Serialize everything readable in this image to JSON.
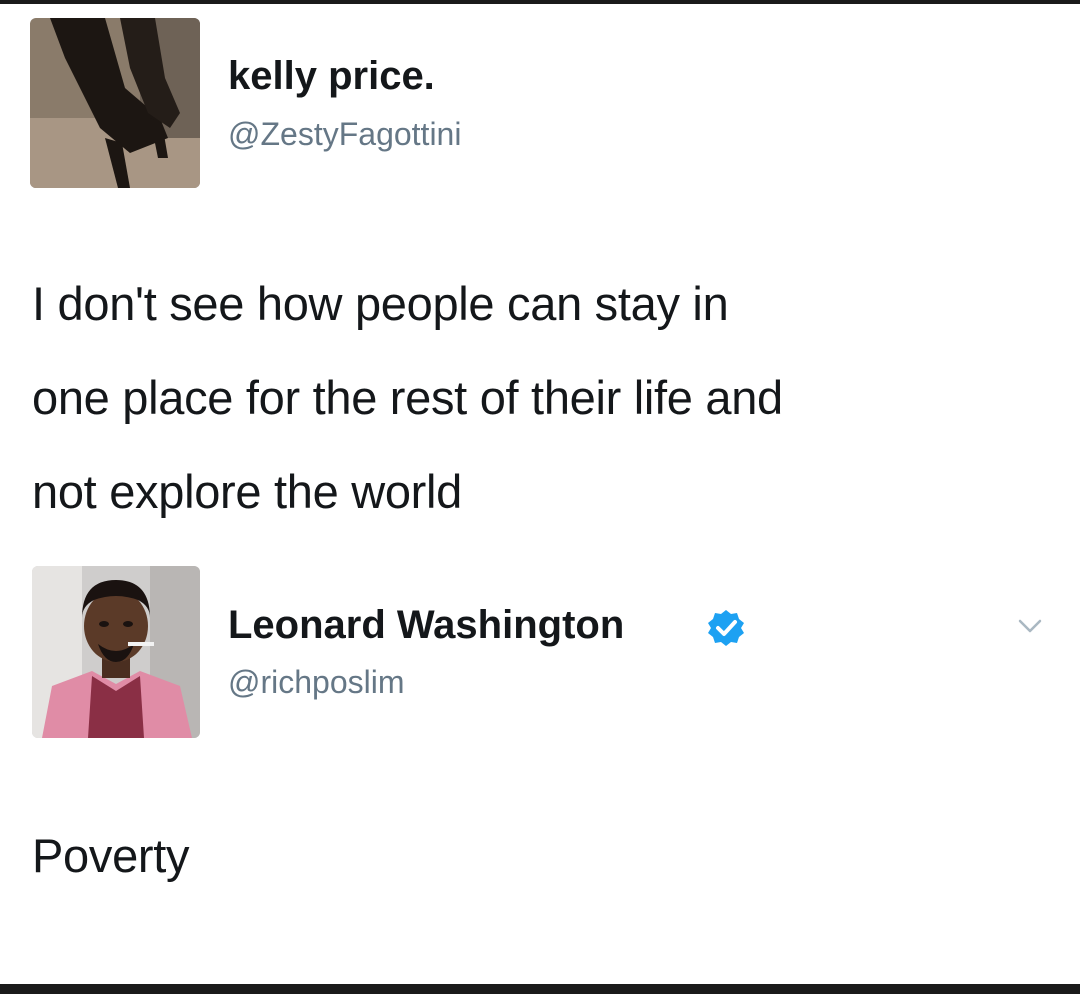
{
  "tweets": [
    {
      "name": "kelly price.",
      "handle": "@ZestyFagottini",
      "verified": false,
      "avatar_icon": "boots-photo-icon",
      "text_lines": [
        "I don't see how people can stay in",
        "one place for the rest of their life and",
        "not explore the world"
      ]
    },
    {
      "name": "Leonard Washington",
      "handle": "@richposlim",
      "verified": true,
      "avatar_icon": "man-pink-suit-photo-icon",
      "text_lines": [
        "Poverty"
      ]
    }
  ],
  "colors": {
    "name": "#14171a",
    "handle": "#657786",
    "verified": "#1da1f2",
    "background": "#ffffff"
  }
}
